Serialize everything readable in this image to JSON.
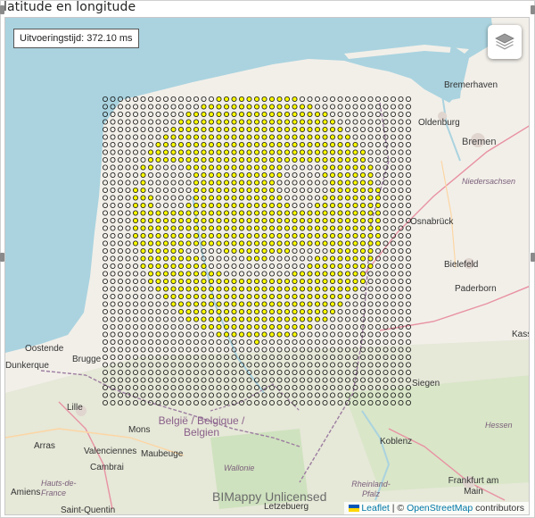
{
  "visual": {
    "title": "latitude en longitude",
    "execution_time": "Uitvoeringstijd: 372.10 ms",
    "watermark": "BIMappy Unlicensed",
    "attribution": {
      "leaflet": "Leaflet",
      "separator": " | © ",
      "osm": "OpenStreetMap",
      "contributors": " contributors"
    },
    "layers_icon": "layers-icon"
  },
  "map": {
    "places": [
      {
        "name": "Bremerhaven",
        "type": "city"
      },
      {
        "name": "Oldenburg",
        "type": "city"
      },
      {
        "name": "Bremen",
        "type": "big"
      },
      {
        "name": "Niedersachsen",
        "type": "region"
      },
      {
        "name": "Osnabrück",
        "type": "city"
      },
      {
        "name": "Bielefeld",
        "type": "city"
      },
      {
        "name": "Paderborn",
        "type": "city"
      },
      {
        "name": "Kass",
        "type": "city"
      },
      {
        "name": "Oostende",
        "type": "city"
      },
      {
        "name": "Brugge",
        "type": "city"
      },
      {
        "name": "Dunkerque",
        "type": "city"
      },
      {
        "name": "Lille",
        "type": "city"
      },
      {
        "name": "Arras",
        "type": "city"
      },
      {
        "name": "Valenciennes",
        "type": "city"
      },
      {
        "name": "Cambrai",
        "type": "city"
      },
      {
        "name": "Maubeuge",
        "type": "city"
      },
      {
        "name": "Mons",
        "type": "city"
      },
      {
        "name": "Wallonie",
        "type": "region"
      },
      {
        "name": "Amiens",
        "type": "city"
      },
      {
        "name": "Hauts-de-France",
        "type": "region"
      },
      {
        "name": "Saint-Quentin",
        "type": "city"
      },
      {
        "name": "Siegen",
        "type": "city"
      },
      {
        "name": "Koblenz",
        "type": "city"
      },
      {
        "name": "Hessen",
        "type": "region"
      },
      {
        "name": "Rheinland-Pfalz",
        "type": "region"
      },
      {
        "name": "Frankfurt am Main",
        "type": "city"
      },
      {
        "name": "Letzebuerg",
        "type": "city"
      },
      {
        "name": "België / Belgique / Belgien",
        "type": "country"
      }
    ],
    "grid": {
      "columns": 41,
      "rows": 41,
      "point_color": "#ffff00",
      "point_stroke": "#111111"
    },
    "smiley": {
      "face_radius": 16.5,
      "eye_radius": 3.2,
      "mouth_outer": 12.4,
      "mouth_inner": 9.6
    }
  }
}
